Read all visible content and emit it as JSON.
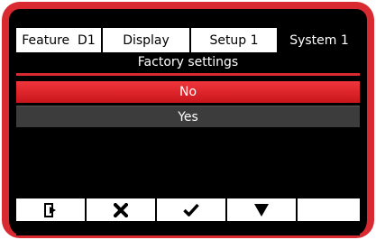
{
  "colors": {
    "accent": "#d82a30",
    "selected_option": "#e02a30",
    "unselected_option": "#3c3c3c",
    "screen_bg": "#000000"
  },
  "tabs": [
    {
      "label": "Feature  D1",
      "active": false
    },
    {
      "label": "Display",
      "active": false
    },
    {
      "label": "Setup 1",
      "active": false
    },
    {
      "label": "System 1",
      "active": true
    }
  ],
  "menu": {
    "title": "Factory settings",
    "options": [
      {
        "label": "No",
        "selected": true
      },
      {
        "label": "Yes",
        "selected": false
      }
    ]
  },
  "softkeys": [
    {
      "icon": "exit-icon"
    },
    {
      "icon": "cancel-x-icon"
    },
    {
      "icon": "confirm-check-icon"
    },
    {
      "icon": "down-triangle-icon"
    },
    {
      "icon": ""
    }
  ]
}
